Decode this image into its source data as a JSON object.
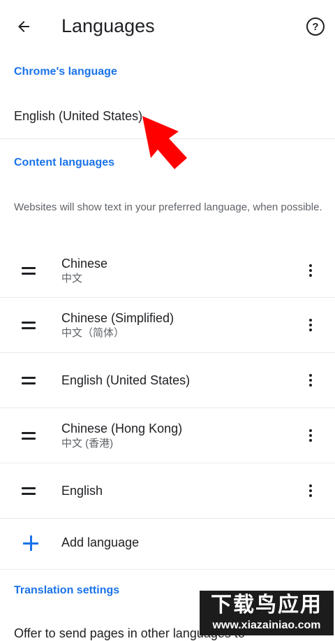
{
  "header": {
    "title": "Languages",
    "back_icon": "arrow-left-icon",
    "help_icon": "help-circle-icon"
  },
  "chrome_language": {
    "section_title": "Chrome's language",
    "current": "English (United States)"
  },
  "content_languages": {
    "section_title": "Content languages",
    "description": "Websites will show text in your preferred language, when possible.",
    "items": [
      {
        "name": "Chinese",
        "native": "中文"
      },
      {
        "name": "Chinese (Simplified)",
        "native": "中文（简体）"
      },
      {
        "name": "English (United States)",
        "native": ""
      },
      {
        "name": "Chinese (Hong Kong)",
        "native": "中文 (香港)"
      },
      {
        "name": "English",
        "native": ""
      }
    ],
    "add_label": "Add language"
  },
  "translation": {
    "section_title": "Translation settings",
    "offer_text": "Offer to send pages in other languages to"
  },
  "watermark": {
    "top": "下载鸟应用",
    "bottom": "www.xiazainiao.com"
  },
  "colors": {
    "accent": "#1a73e8",
    "text": "#202124",
    "secondary": "#5f6368",
    "divider": "#e8eaed",
    "arrow": "#ff0000"
  }
}
